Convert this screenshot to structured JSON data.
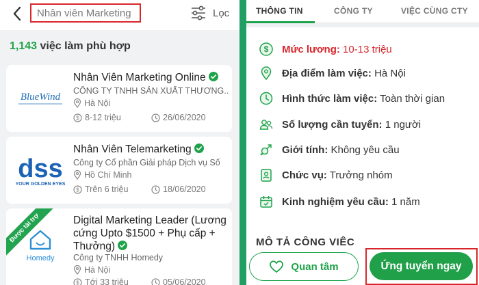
{
  "search": {
    "query": "Nhân viên Marketing"
  },
  "filter": {
    "label": "Lọc"
  },
  "results": {
    "count": "1,143",
    "suffix": " việc làm phù hợp"
  },
  "jobs": [
    {
      "title": "Nhân Viên Marketing Online",
      "company": "CÔNG TY TNHH SẢN XUẤT THƯƠNG...",
      "location": "Hà Nội",
      "salary": "8-12 triệu",
      "deadline": "26/06/2020",
      "logo_text": "BlueWind",
      "logo_sub": ""
    },
    {
      "title": "Nhân Viên Telemarketing",
      "company": "Công ty Cổ phần Giải pháp Dịch vụ Số",
      "location": "Hồ Chí Minh",
      "salary": "Trên 6 triệu",
      "deadline": "18/06/2020",
      "logo_text": "dss",
      "logo_sub": "YOUR GOLDEN EYES"
    },
    {
      "title": "Digital Marketing Leader (Lương cứng Upto $1500 + Phụ cấp + Thưởng)",
      "company": "Công ty TNHH Homedy",
      "location": "Hà Nội",
      "salary": "Tới 33 triệu",
      "deadline": "05/06/2020",
      "logo_text": "Homedy",
      "sponsor": "Được tài trợ"
    }
  ],
  "tabs": [
    "THÔNG TIN",
    "CÔNG TY",
    "VIỆC CÙNG CTY"
  ],
  "details": [
    {
      "label": "Mức lương:",
      "value": " 10-13 triệu",
      "icon": "salary-icon"
    },
    {
      "label": "Địa điểm làm việc:",
      "value": " Hà Nội",
      "icon": "location-pin-icon"
    },
    {
      "label": "Hình thức làm việc:",
      "value": " Toàn thời gian",
      "icon": "clock-icon"
    },
    {
      "label": "Số lượng cần tuyển:",
      "value": " 1 người",
      "icon": "people-icon"
    },
    {
      "label": "Giới tính:",
      "value": " Không yêu cầu",
      "icon": "gender-icon"
    },
    {
      "label": "Chức vụ:",
      "value": " Trưởng nhóm",
      "icon": "id-badge-icon"
    },
    {
      "label": "Kinh nghiệm yêu cầu:",
      "value": " 1 năm",
      "icon": "calendar-icon"
    }
  ],
  "description_heading": "MÔ TẢ CÔNG VIỆC",
  "actions": {
    "save_label": "Quan tâm",
    "apply_label": "Ứng tuyển ngay"
  },
  "colors": {
    "accent": "#21a04a",
    "highlight": "#d8262b"
  }
}
